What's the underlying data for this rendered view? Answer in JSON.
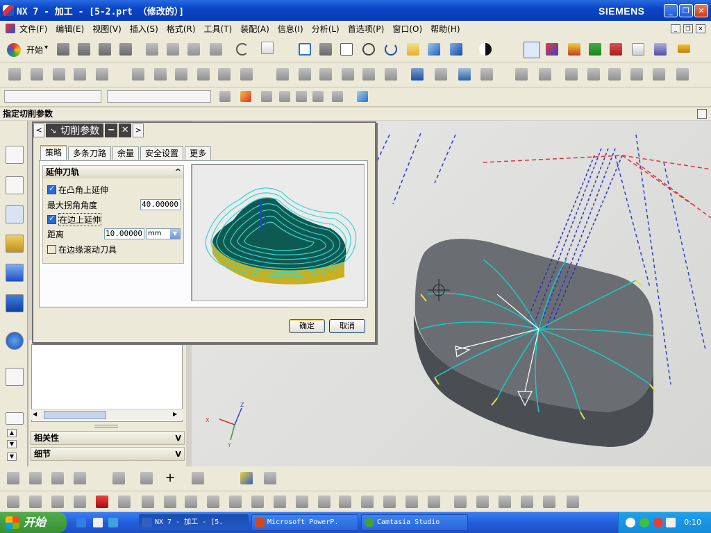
{
  "window": {
    "title": "NX 7 - 加工 - [5-2.prt （修改的）]",
    "brand": "SIEMENS",
    "minimize": "_",
    "maximize": "❐",
    "close": "✕"
  },
  "menubar": {
    "items": [
      "文件(F)",
      "编辑(E)",
      "视图(V)",
      "插入(S)",
      "格式(R)",
      "工具(T)",
      "装配(A)",
      "信息(I)",
      "分析(L)",
      "首选项(P)",
      "窗口(O)",
      "帮助(H)"
    ]
  },
  "toolbar": {
    "start_label": "开始",
    "start_arrow": "▾"
  },
  "status": {
    "prompt": "指定切削参数"
  },
  "dialog": {
    "title": "切削参数",
    "back": "<",
    "forward": ">",
    "minus": "−",
    "close": "✕",
    "tabs": [
      "策略",
      "多条刀路",
      "余量",
      "安全设置",
      "更多"
    ],
    "active_tab": "策略",
    "group_title": "延伸刀轨",
    "collapse": "^",
    "extend_convex": "在凸角上延伸",
    "extend_convex_checked": true,
    "max_angle_label": "最大拐角角度",
    "max_angle_value": "40.00000",
    "extend_edge": "在边上延伸",
    "extend_edge_checked": true,
    "distance_label": "距离",
    "distance_value": "10.00000",
    "distance_unit": "mm",
    "roll_tool": "在边缘滚动刀具",
    "roll_tool_checked": false,
    "ok": "确定",
    "cancel": "取消"
  },
  "sidepanel": {
    "related": "相关性",
    "details": "细节",
    "chevron": "V"
  },
  "taskbar": {
    "start": "开始",
    "items": [
      {
        "label": "NX 7 - 加工 - [5.",
        "icon_color": "#3060c0"
      },
      {
        "label": "Microsoft PowerP.",
        "icon_color": "#d04820"
      },
      {
        "label": "Camtasia Studio",
        "icon_color": "#40a040"
      }
    ],
    "clock": "0:10"
  },
  "colors": {
    "title_bar": "#0a46c8",
    "accent_tab": "#e68b2c",
    "toolpath_cyan": "#18c8c0",
    "toolpath_blue": "#3030d0",
    "toolpath_red": "#e03040",
    "part_gray": "#5a5e62"
  }
}
